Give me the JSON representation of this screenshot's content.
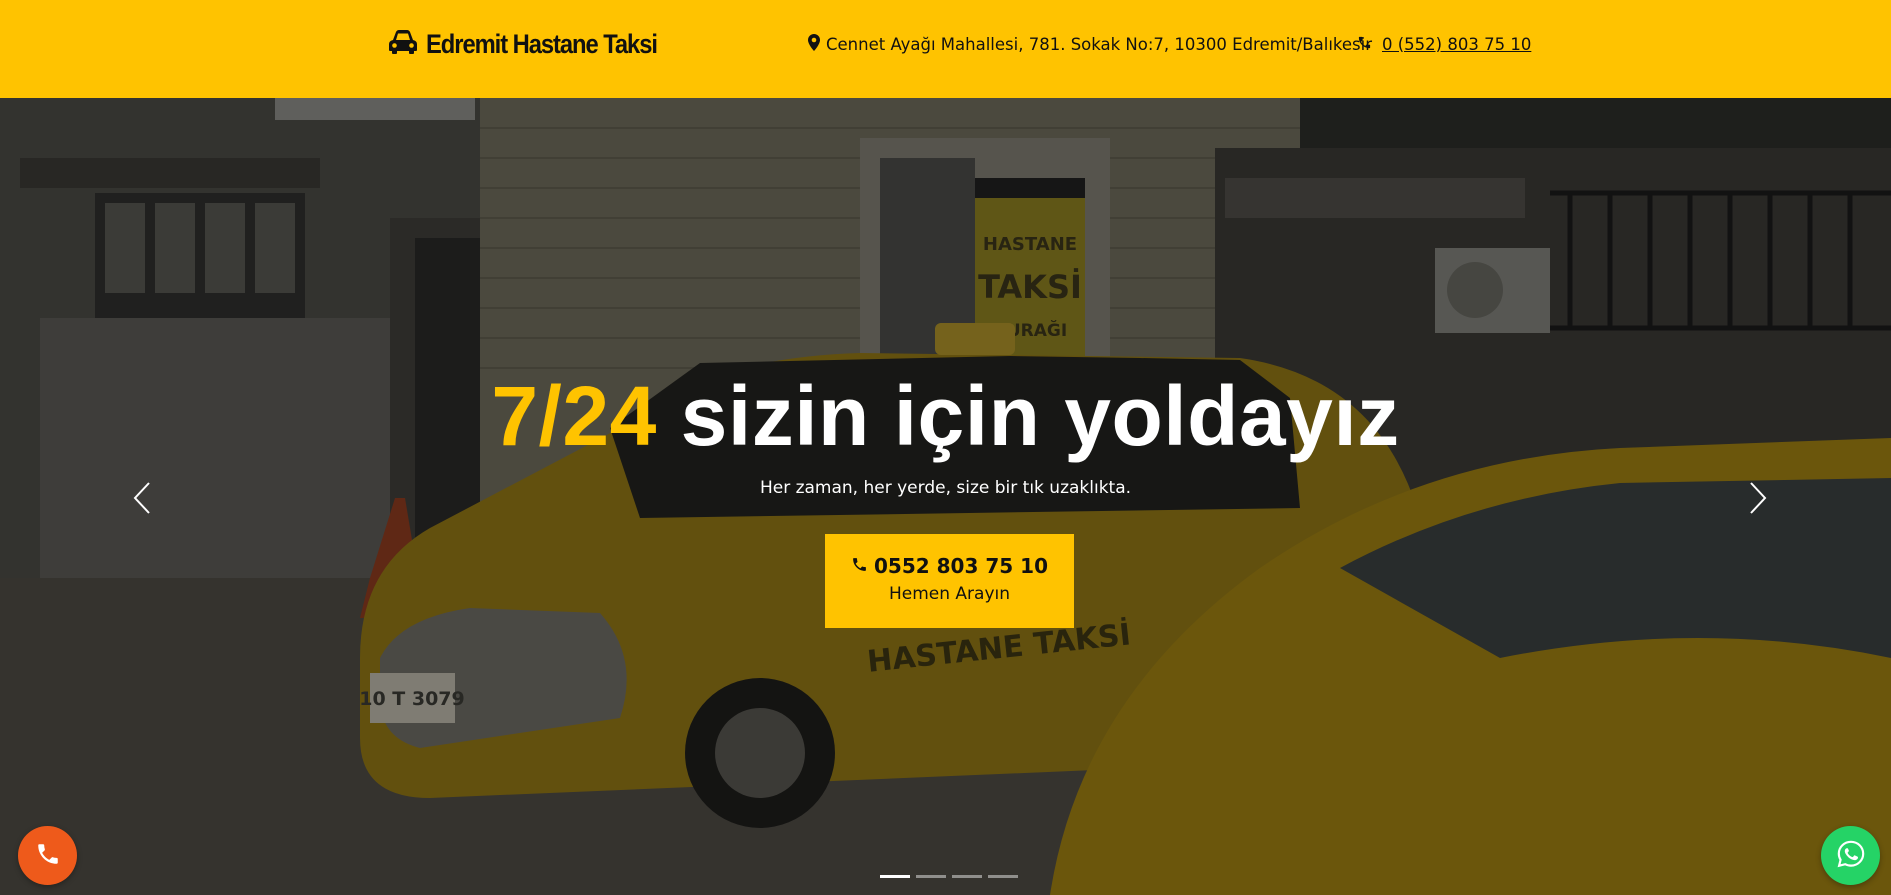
{
  "header": {
    "brand_name": "Edremit Hastane Taksi",
    "address": "Cennet Ayağı Mahallesi, 781. Sokak No:7, 10300 Edremit/Balıkesir",
    "phone": "0 (552) 803 75 10",
    "brand_color": "#ffc300"
  },
  "hero": {
    "title_accent": "7/24",
    "title_rest": " sizin için yoldayız",
    "subtitle": "Her zaman, her yerde, size bir tık uzaklıkta.",
    "cta_number": "0552 803 75 10",
    "cta_label": "Hemen Arayın",
    "slides_total": 4,
    "active_slide": 1,
    "scene_sign_1": "HASTANE",
    "scene_sign_2": "TAKSİ",
    "scene_sign_3": "DURAĞI",
    "scene_car_text": "HASTANE TAKSİ",
    "scene_plate": "10 T 3079"
  },
  "floating": {
    "call_color": "#ee5a1b",
    "whatsapp_color": "#25d366"
  },
  "icons": {
    "brand": "car-icon",
    "address": "map-marker-icon",
    "phone": "phone-icon",
    "prev": "chevron-left-icon",
    "next": "chevron-right-icon",
    "whatsapp": "whatsapp-icon"
  }
}
